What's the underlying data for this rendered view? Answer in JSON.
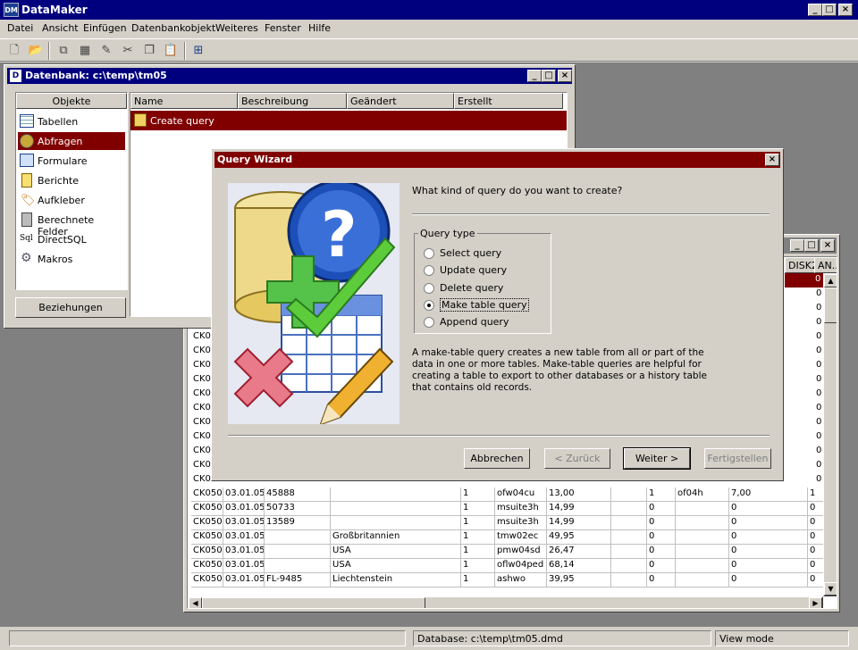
{
  "app": {
    "title": "DataMaker",
    "icon_text": "DM"
  },
  "menu": [
    "Datei",
    "Ansicht",
    "Einfügen",
    "Datenbankobjekt",
    "Weiteres",
    "Fenster",
    "Hilfe"
  ],
  "db_window": {
    "title": "Datenbank: c:\\temp\\tm05",
    "objects_header": "Objekte",
    "objects": [
      "Tabellen",
      "Abfragen",
      "Formulare",
      "Berichte",
      "Aufkleber",
      "Berechnete Felder",
      "DirectSQL",
      "Makros"
    ],
    "relations_button": "Beziehungen",
    "columns": [
      "Name",
      "Beschreibung",
      "Geändert",
      "Erstellt"
    ],
    "items": [
      "Create query"
    ]
  },
  "table_window": {
    "partial_headers": [
      "DISK2",
      "AN..."
    ],
    "rows": [
      [
        "CK050",
        "03.01.05",
        "45888",
        "",
        "1",
        "ofw04cu",
        "13,00",
        "",
        "1",
        "of04h",
        "7,00",
        "1"
      ],
      [
        "CK050",
        "03.01.05",
        "50733",
        "",
        "1",
        "msuite3h",
        "14,99",
        "",
        "0",
        "",
        "0",
        "0"
      ],
      [
        "CK050",
        "03.01.05",
        "13589",
        "",
        "1",
        "msuite3h",
        "14,99",
        "",
        "0",
        "",
        "0",
        "0"
      ],
      [
        "CK050",
        "03.01.05",
        "",
        "Großbritannien",
        "1",
        "tmw02ec",
        "49,95",
        "",
        "0",
        "",
        "0",
        "0"
      ],
      [
        "CK050",
        "03.01.05",
        "",
        "USA",
        "1",
        "pmw04sd",
        "26,47",
        "",
        "0",
        "",
        "0",
        "0"
      ],
      [
        "CK050",
        "03.01.05",
        "",
        "USA",
        "1",
        "oflw04ped",
        "68,14",
        "",
        "0",
        "",
        "0",
        "0"
      ],
      [
        "CK050",
        "03.01.05",
        "FL-9485",
        "Liechtenstein",
        "1",
        "ashwo",
        "39,95",
        "",
        "0",
        "",
        "0",
        "0"
      ]
    ],
    "partial_left": [
      "CK05",
      "CK05",
      "CK05",
      "CK05",
      "CK05",
      "CK05",
      "CK05",
      "CK05",
      "CK05",
      "CK05",
      "CK05",
      "CK05"
    ],
    "partial_right": [
      "0",
      "0",
      "0",
      "0",
      "0",
      "0",
      "0",
      "0",
      "0",
      "0",
      "0",
      "0",
      "0",
      "0",
      "0"
    ]
  },
  "wizard": {
    "title": "Query Wizard",
    "question": "What kind of query do you want to create?",
    "group_label": "Query type",
    "options": [
      "Select query",
      "Update query",
      "Delete query",
      "Make table query",
      "Append query"
    ],
    "selected_index": 3,
    "description": "A make-table query creates a new table from all or part of the data in one or more tables. Make-table queries are helpful for creating a table to export to other databases or a history table that contains old records.",
    "buttons": {
      "cancel": "Abbrechen",
      "back": "< Zurück",
      "next": "Weiter >",
      "finish": "Fertigstellen"
    }
  },
  "statusbar": {
    "database": "Database: c:\\temp\\tm05.dmd",
    "mode": "View mode"
  },
  "colors": {
    "title_active": "#00007f",
    "title_wizard": "#800000",
    "selection": "#800000",
    "face": "#d4d0c8",
    "mdi": "#808080"
  }
}
